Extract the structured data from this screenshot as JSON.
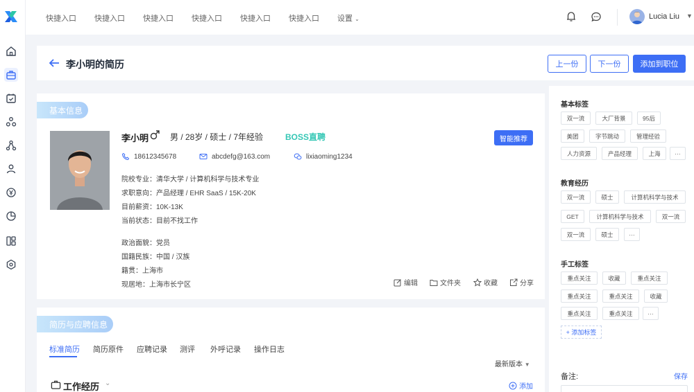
{
  "topbar": {
    "quick_links": [
      "快捷入口",
      "快捷入口",
      "快捷入口",
      "快捷入口",
      "快捷入口",
      "快捷入口"
    ],
    "settings_label": "设置",
    "user_name": "Lucia Liu"
  },
  "header": {
    "title": "李小明的简历",
    "prev_label": "上一份",
    "next_label": "下一份",
    "add_position_label": "添加到职位"
  },
  "basic": {
    "section_label": "基本信息",
    "name": "李小明",
    "summary": "男 / 28岁 / 硕士 / 7年经验",
    "source_badge": "BOSS直聘",
    "smart_recommend_label": "智能推荐",
    "phone": "18612345678",
    "email": "abcdefg@163.com",
    "wechat": "lixiaoming1234",
    "school_major": "院校专业：清华大学 / 计算机科学与技术专业",
    "intention": "求职意向：产品经理 / EHR SaaS / 15K-20K",
    "current_salary": "目前薪资：10K-13K",
    "current_status": "当前状态：目前不找工作",
    "political": "政治面貌：党员",
    "nationality": "国籍民族：中国 / 汉族",
    "native_place": "籍贯：上海市",
    "residence": "现居地：上海市长宁区",
    "actions": [
      "编辑",
      "文件夹",
      "收藏",
      "分享"
    ]
  },
  "resume": {
    "section_label": "简历与应聘信息",
    "tabs": [
      "标准简历",
      "简历原件",
      "应聘记录",
      "测评",
      "外呼记录",
      "操作日志"
    ],
    "version_label": "最新版本",
    "work_title": "工作经历",
    "add_label": "添加"
  },
  "tags": {
    "basic_title": "基本标签",
    "basic": [
      "双一流",
      "大厂背景",
      "95后",
      "美团",
      "字节跳动",
      "管理经验",
      "人力资源",
      "产品经理",
      "上海"
    ],
    "edu_title": "教育经历",
    "edu": [
      "双一流",
      "硕士",
      "计算机科学与技术",
      "GET",
      "计算机科学与技术",
      "双一流",
      "双一流",
      "硕士"
    ],
    "manual_title": "手工标签",
    "manual": [
      "重点关注",
      "收藏",
      "重点关注",
      "重点关注",
      "重点关注",
      "收藏",
      "重点关注",
      "重点关注"
    ],
    "more": "···",
    "add_tag_label": "+ 添加标签",
    "note_title": "备注:",
    "save_label": "保存"
  },
  "colors": {
    "primary": "#3d6ef5",
    "boss": "#35c7b5"
  }
}
